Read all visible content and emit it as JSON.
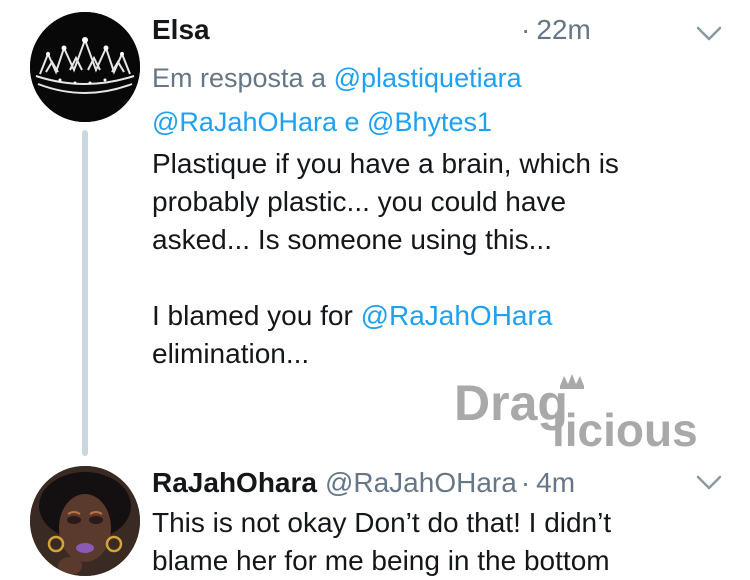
{
  "tweet1": {
    "name": "Elsa",
    "dot": "·",
    "time": "22m",
    "reply_prefix": "Em resposta a",
    "reply_handle1": "@plastiquetiara",
    "reply_handle2": "@RaJahOHara",
    "reply_conj": "e",
    "reply_handle3": "@Bhytes1",
    "body_line1": "Plastique if you have a brain, which is",
    "body_line2": "probably plastic... you could have",
    "body_line3": "asked... Is someone using this...",
    "body_line4_prefix": "I blamed you for",
    "body_line4_mention": "@RaJahOHara",
    "body_line5": "elimination..."
  },
  "tweet2": {
    "name": "RaJahOhara",
    "handle": "@RaJahOHara",
    "dot": "·",
    "time": "4m",
    "body_line1": "This is not okay Don’t do that! I didn’t",
    "body_line2": "blame her for me being in the bottom"
  },
  "watermark": {
    "part1": "Drag",
    "part2": "licious"
  },
  "colors": {
    "link": "#1da1f2",
    "secondary_text": "#657786",
    "thread_line": "#ccd6dd",
    "watermark": "#a9a9a9"
  },
  "icons": {
    "chevron": "chevron-down-icon",
    "crown": "tiara-avatar",
    "watermark_crown": "crown-icon"
  }
}
